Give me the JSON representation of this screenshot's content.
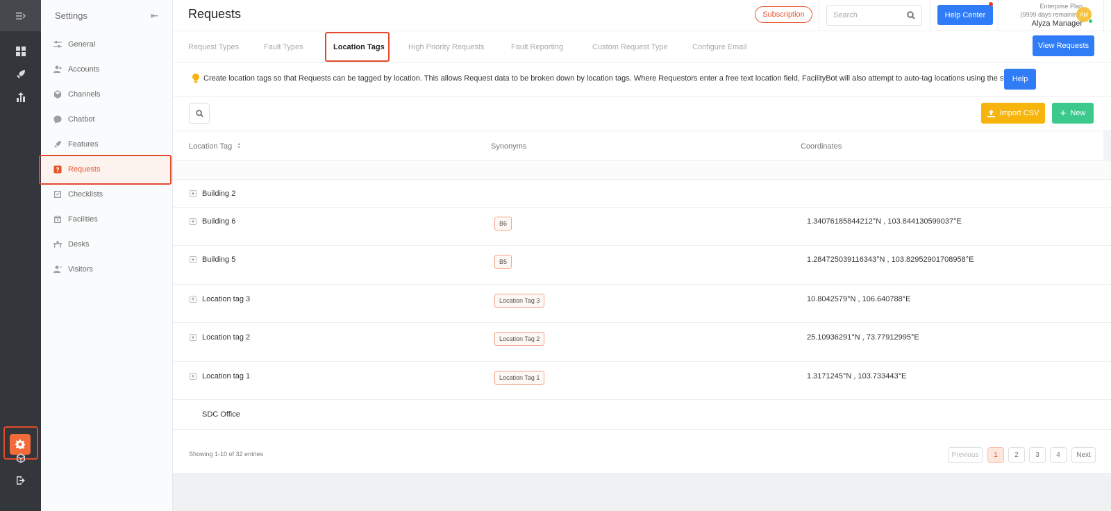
{
  "sidebar": {
    "title": "Settings",
    "items": [
      {
        "label": "General",
        "icon": "sliders-icon"
      },
      {
        "label": "Accounts",
        "icon": "users-icon"
      },
      {
        "label": "Channels",
        "icon": "cube-icon"
      },
      {
        "label": "Chatbot",
        "icon": "chat-icon"
      },
      {
        "label": "Features",
        "icon": "rocket-icon"
      },
      {
        "label": "Requests",
        "icon": "question-icon",
        "active": true
      },
      {
        "label": "Checklists",
        "icon": "checklist-icon"
      },
      {
        "label": "Facilities",
        "icon": "calendar-icon"
      },
      {
        "label": "Desks",
        "icon": "desk-icon"
      },
      {
        "label": "Visitors",
        "icon": "visitor-icon"
      }
    ]
  },
  "header": {
    "title": "Requests",
    "subscription_label": "Subscription",
    "search_placeholder": "Search",
    "help_center_label": "Help Center",
    "plan_name": "Enterprise Plan",
    "plan_remaining": "(9999 days remaining)",
    "user_name": "Alyza Manager",
    "avatar_initials": "AM"
  },
  "tabs": [
    {
      "label": "Request Types"
    },
    {
      "label": "Fault Types"
    },
    {
      "label": "Location Tags",
      "active": true
    },
    {
      "label": "High Priority Requests"
    },
    {
      "label": "Fault Reporting"
    },
    {
      "label": "Custom Request Type"
    },
    {
      "label": "Configure Email"
    }
  ],
  "view_requests_label": "View Requests",
  "info": {
    "text": "Create location tags so that Requests can be tagged by location. This allows Request data to be broken down by location tags. Where Requestors enter a free text location field, FacilityBot will also attempt to auto-tag locations using the synonyms.",
    "help_label": "Help"
  },
  "toolbar": {
    "import_label": "Import CSV",
    "new_label": "New"
  },
  "table": {
    "columns": [
      "Location Tag",
      "Synonyms",
      "Coordinates"
    ],
    "rows": [
      {
        "name": "Building 2",
        "synonym": "",
        "coordinates": ""
      },
      {
        "name": "Building 6",
        "synonym": "B6",
        "coordinates": "1.34076185844212°N , 103.844130599037°E"
      },
      {
        "name": "Building 5",
        "synonym": "B5",
        "coordinates": "1.284725039116343°N , 103.82952901708958°E"
      },
      {
        "name": "Location tag 3",
        "synonym": "Location Tag 3",
        "coordinates": "10.8042579°N , 106.640788°E"
      },
      {
        "name": "Location tag 2",
        "synonym": "Location Tag 2",
        "coordinates": "25.10936291°N , 73.77912995°E"
      },
      {
        "name": "Location tag 1",
        "synonym": "Location Tag 1",
        "coordinates": "1.3171245°N , 103.733443°E"
      },
      {
        "name": "SDC Office",
        "synonym": "",
        "coordinates": ""
      }
    ]
  },
  "pagination": {
    "showing": "Showing 1-10 of 32 entries",
    "previous": "Previous",
    "pages": [
      "1",
      "2",
      "3",
      "4"
    ],
    "current": "1",
    "next": "Next"
  },
  "colors": {
    "accent": "#e8542f",
    "primary": "#2f7cf6",
    "warning": "#f6b40c",
    "success": "#3cc98d",
    "rail": "#33363b"
  }
}
